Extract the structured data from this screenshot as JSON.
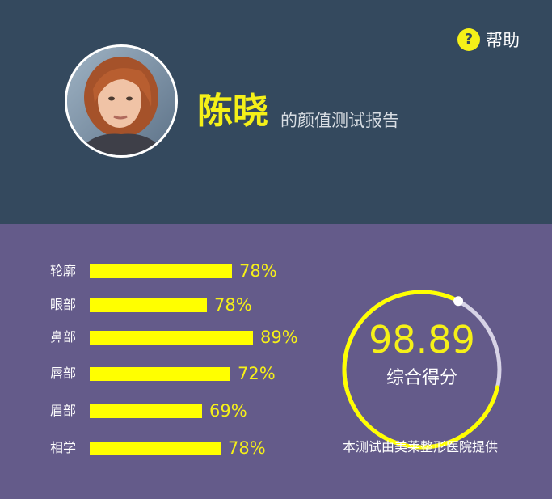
{
  "header": {
    "help_label": "帮助",
    "help_icon": "question-circle-icon",
    "name": "陈晓",
    "subtitle": "的颜值测试报告"
  },
  "colors": {
    "header_bg": "#34495e",
    "body_bg": "#645b8a",
    "accent": "#f5f018",
    "bar": "#ffff00",
    "gauge_track": "#d7d3e6"
  },
  "bars": {
    "items": [
      {
        "label": "轮廓",
        "value_text": "78%",
        "level": 0.84
      },
      {
        "label": "眼部",
        "value_text": "78%",
        "level": 0.69
      },
      {
        "label": "鼻部",
        "value_text": "89%",
        "level": 0.96
      },
      {
        "label": "唇部",
        "value_text": "72%",
        "level": 0.83
      },
      {
        "label": "眉部",
        "value_text": "69%",
        "level": 0.66
      },
      {
        "label": "相学",
        "value_text": "78%",
        "level": 0.77
      }
    ]
  },
  "score": {
    "value": "98.89",
    "label": "综合得分",
    "level": 0.9889
  },
  "footnote": "本测试由美莱整形医院提供"
}
